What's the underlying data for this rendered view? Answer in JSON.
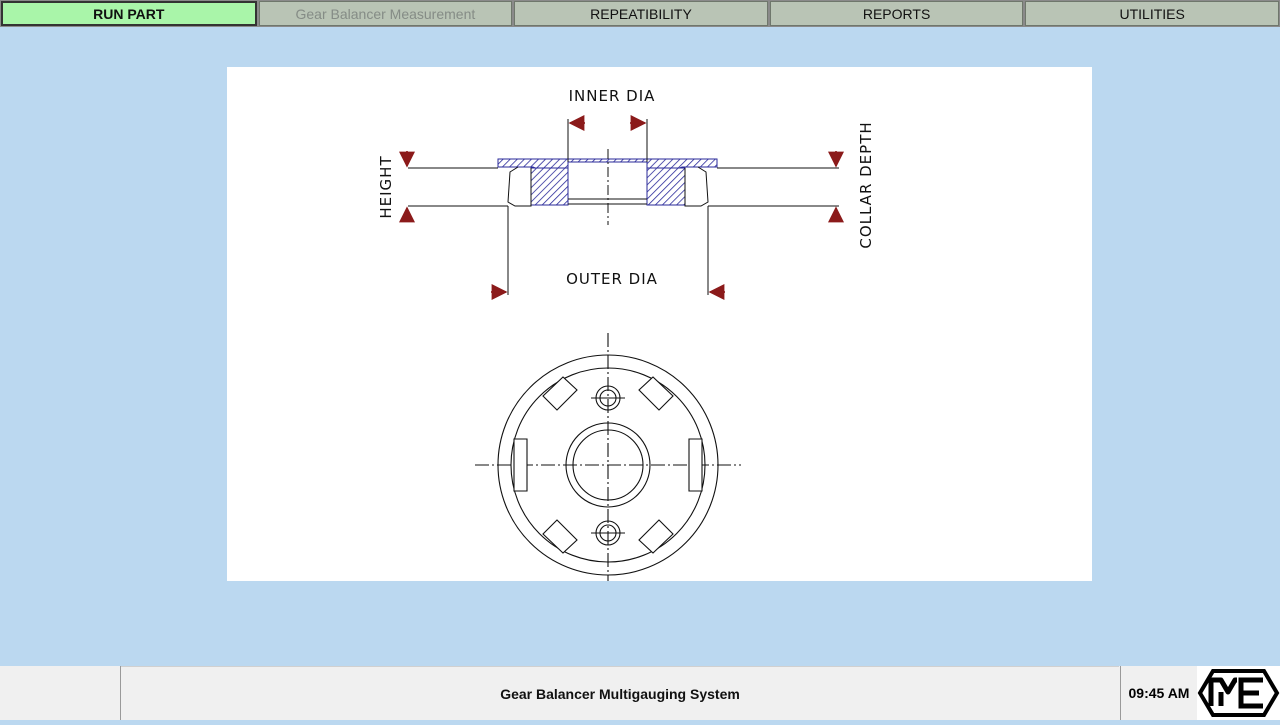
{
  "tabs": [
    {
      "label": "RUN PART",
      "state": "active"
    },
    {
      "label": "Gear Balancer Measurement",
      "state": "disabled"
    },
    {
      "label": "REPEATIBILITY",
      "state": "normal"
    },
    {
      "label": "REPORTS",
      "state": "normal"
    },
    {
      "label": "UTILITIES",
      "state": "normal"
    }
  ],
  "drawing": {
    "inner_dia": "INNER DIA",
    "outer_dia": "OUTER DIA",
    "height": "HEIGHT",
    "collar_depth": "COLLAR DEPTH"
  },
  "status": {
    "title": "Gear Balancer Multigauging System",
    "time": "09:45 AM",
    "logo_text": "ME"
  },
  "colors": {
    "background": "#bbd8f0",
    "active_tab": "#a9f5a9",
    "tab": "#b9c4b5",
    "arrow": "#8b1a1a",
    "hatch": "#2a2a9a"
  }
}
